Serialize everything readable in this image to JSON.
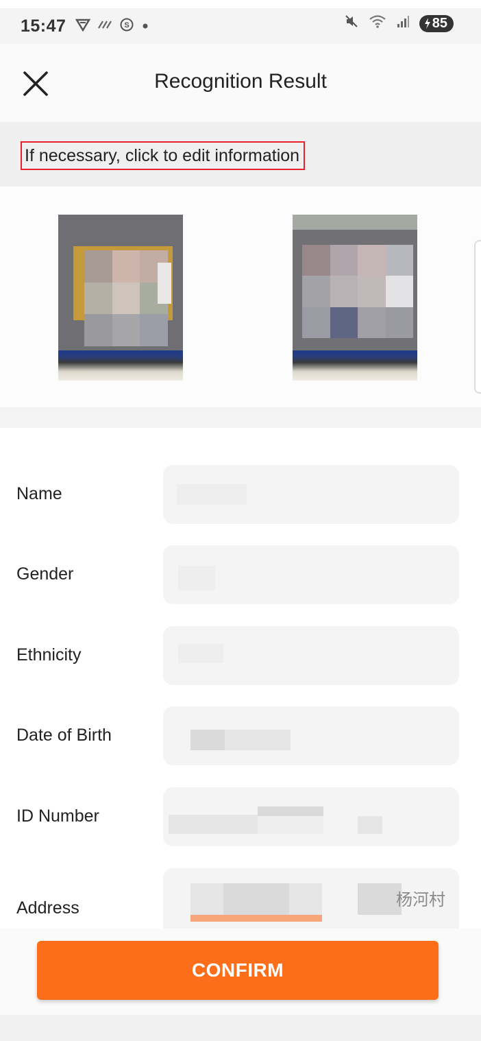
{
  "status_bar": {
    "time": "15:47",
    "battery": "85",
    "icons_left": [
      "vpn-icon",
      "data-icon",
      "sync-icon",
      "dot-icon"
    ],
    "icons_right": [
      "mute-icon",
      "wifi-icon",
      "signal-icon",
      "battery-icon"
    ]
  },
  "header": {
    "title": "Recognition Result",
    "close_icon": "close-icon"
  },
  "hint": {
    "text": "If necessary, click to edit information",
    "highlight_color": "#e8202a"
  },
  "images": [
    {
      "label": "id-card-front-photo"
    },
    {
      "label": "id-card-back-photo"
    }
  ],
  "form": {
    "fields": [
      {
        "label": "Name",
        "value": ""
      },
      {
        "label": "Gender",
        "value": ""
      },
      {
        "label": "Ethnicity",
        "value": ""
      },
      {
        "label": "Date of Birth",
        "value": ""
      },
      {
        "label": "ID Number",
        "value": ""
      },
      {
        "label": "Address",
        "value": "",
        "visible_tail": "杨河村"
      }
    ]
  },
  "confirm": {
    "label": "CONFIRM",
    "color": "#fc6e1a"
  }
}
